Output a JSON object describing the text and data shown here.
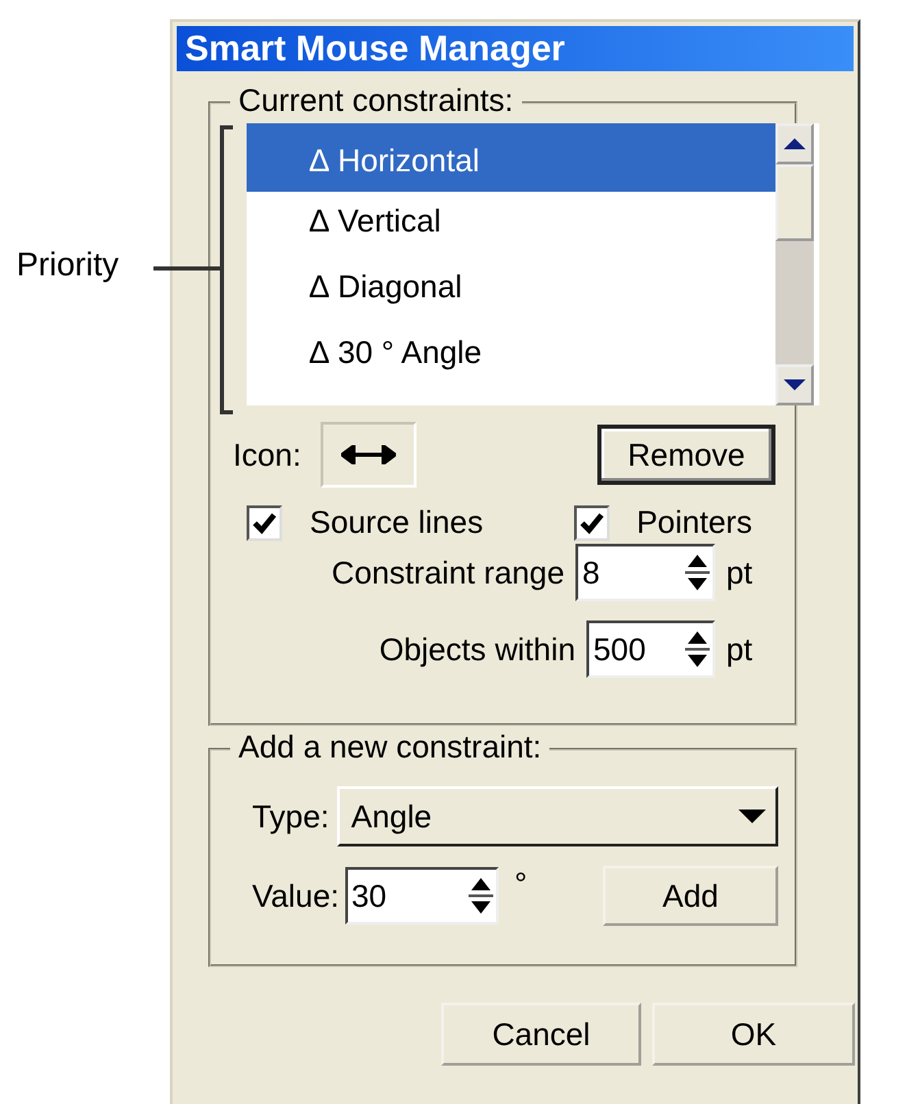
{
  "window": {
    "title": "Smart Mouse Manager"
  },
  "annotation": {
    "label": "Priority"
  },
  "current": {
    "legend": "Current constraints:",
    "items": [
      {
        "symbol": "∆",
        "label": "Horizontal",
        "selected": true
      },
      {
        "symbol": "∆",
        "label": "Vertical",
        "selected": false
      },
      {
        "symbol": "∆",
        "label": "Diagonal",
        "selected": false
      },
      {
        "symbol": "∆",
        "label": "30 ° Angle",
        "selected": false
      }
    ],
    "icon_label": "Icon:",
    "remove_button": "Remove",
    "checkboxes": [
      {
        "label": "Source lines",
        "checked": true
      },
      {
        "label": "Pointers",
        "checked": true
      }
    ],
    "spinners": [
      {
        "label": "Constraint range",
        "value": "8",
        "unit": "pt"
      },
      {
        "label": "Objects within",
        "value": "500",
        "unit": "pt"
      }
    ]
  },
  "add": {
    "legend": "Add a new constraint:",
    "type_label": "Type:",
    "type_value": "Angle",
    "value_label": "Value:",
    "value": "30",
    "unit": "°",
    "add_button": "Add"
  },
  "buttons": [
    "Cancel",
    "OK"
  ]
}
